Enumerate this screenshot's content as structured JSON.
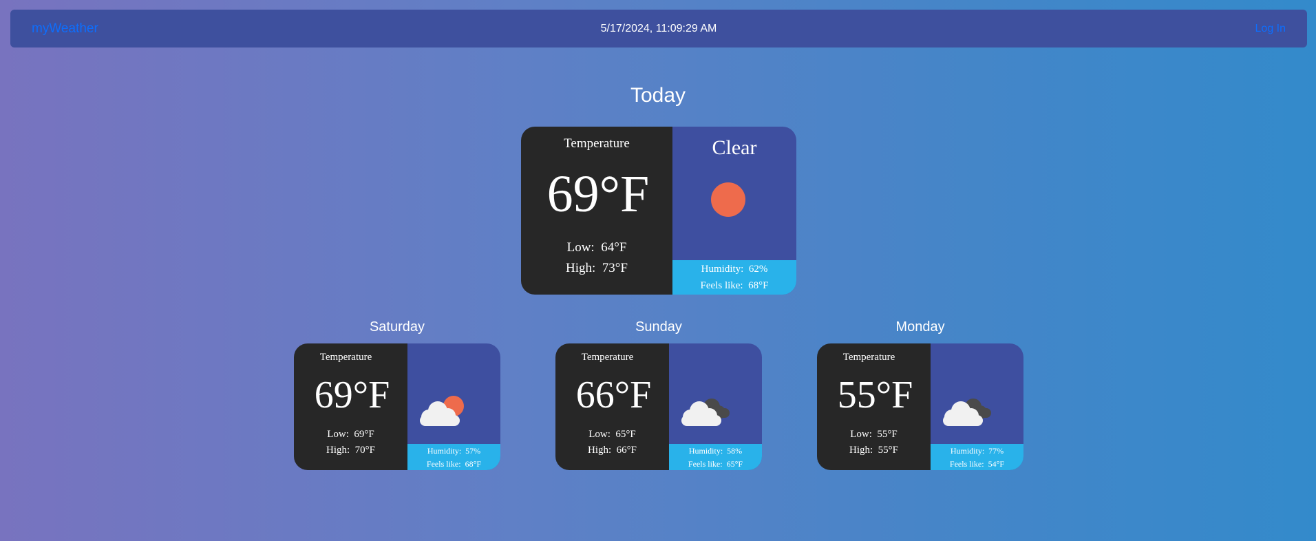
{
  "navbar": {
    "brand": "myWeather",
    "datetime": "5/17/2024, 11:09:29 AM",
    "login": "Log In",
    "link_color": "#0d6efd",
    "background": "#3e509e"
  },
  "today": {
    "heading": "Today",
    "temperature_label": "Temperature",
    "temperature": "69°F",
    "low_label": "Low:",
    "low": "64°F",
    "high_label": "High:",
    "high": "73°F",
    "condition": "Clear",
    "icon": "sun-icon",
    "humidity_label": "Humidity:",
    "humidity": "62%",
    "feels_like_label": "Feels like:",
    "feels_like": "68°F"
  },
  "forecast": [
    {
      "day": "Saturday",
      "temperature_label": "Temperature",
      "temperature": "69°F",
      "low_label": "Low:",
      "low": "69°F",
      "high_label": "High:",
      "high": "70°F",
      "icon": "partly-cloudy-icon",
      "humidity_label": "Humidity:",
      "humidity": "57%",
      "feels_like_label": "Feels like:",
      "feels_like": "68°F"
    },
    {
      "day": "Sunday",
      "temperature_label": "Temperature",
      "temperature": "66°F",
      "low_label": "Low:",
      "low": "65°F",
      "high_label": "High:",
      "high": "66°F",
      "icon": "cloudy-icon",
      "humidity_label": "Humidity:",
      "humidity": "58%",
      "feels_like_label": "Feels like:",
      "feels_like": "65°F"
    },
    {
      "day": "Monday",
      "temperature_label": "Temperature",
      "temperature": "55°F",
      "low_label": "Low:",
      "low": "55°F",
      "high_label": "High:",
      "high": "55°F",
      "icon": "cloudy-icon",
      "humidity_label": "Humidity:",
      "humidity": "77%",
      "feels_like_label": "Feels like:",
      "feels_like": "54°F"
    }
  ],
  "colors": {
    "card_dark": "#272727",
    "card_blue": "#3e4fa0",
    "card_cyan": "#29b2ea",
    "sun": "#ee6b4c"
  }
}
